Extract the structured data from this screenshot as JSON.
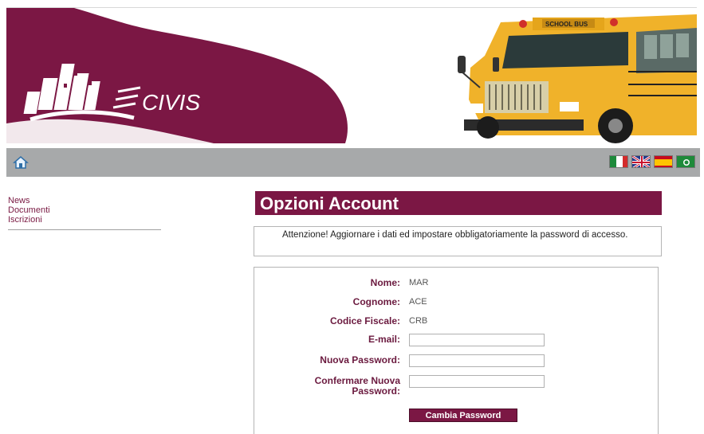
{
  "banner": {
    "logo_text": "CIVIS",
    "bus_sign": "SCHOOL BUS"
  },
  "toolbar": {
    "home_icon": "home-icon",
    "flags": [
      "italian-flag-icon",
      "uk-flag-icon",
      "spanish-flag-icon",
      "green-flag-icon"
    ]
  },
  "sidebar": {
    "items": [
      {
        "label": "News"
      },
      {
        "label": "Documenti"
      },
      {
        "label": "Iscrizioni"
      }
    ]
  },
  "main": {
    "title": "Opzioni Account",
    "notice": "Attenzione! Aggiornare i dati ed impostare obbligatoriamente la password di accesso.",
    "form": {
      "nome_label": "Nome:",
      "nome_value": "MAR",
      "cognome_label": "Cognome:",
      "cognome_value": "ACE",
      "cf_label": "Codice Fiscale:",
      "cf_value": "CRB",
      "email_label": "E-mail:",
      "email_value": "",
      "new_password_label": "Nuova Password:",
      "new_password_value": "",
      "confirm_password_label": "Confermare Nuova Password:",
      "confirm_password_value": "",
      "submit_label": "Cambia Password"
    }
  },
  "colors": {
    "brand": "#7b1744",
    "toolbar": "#a7a9aa",
    "bus_yellow": "#f0b22a"
  }
}
